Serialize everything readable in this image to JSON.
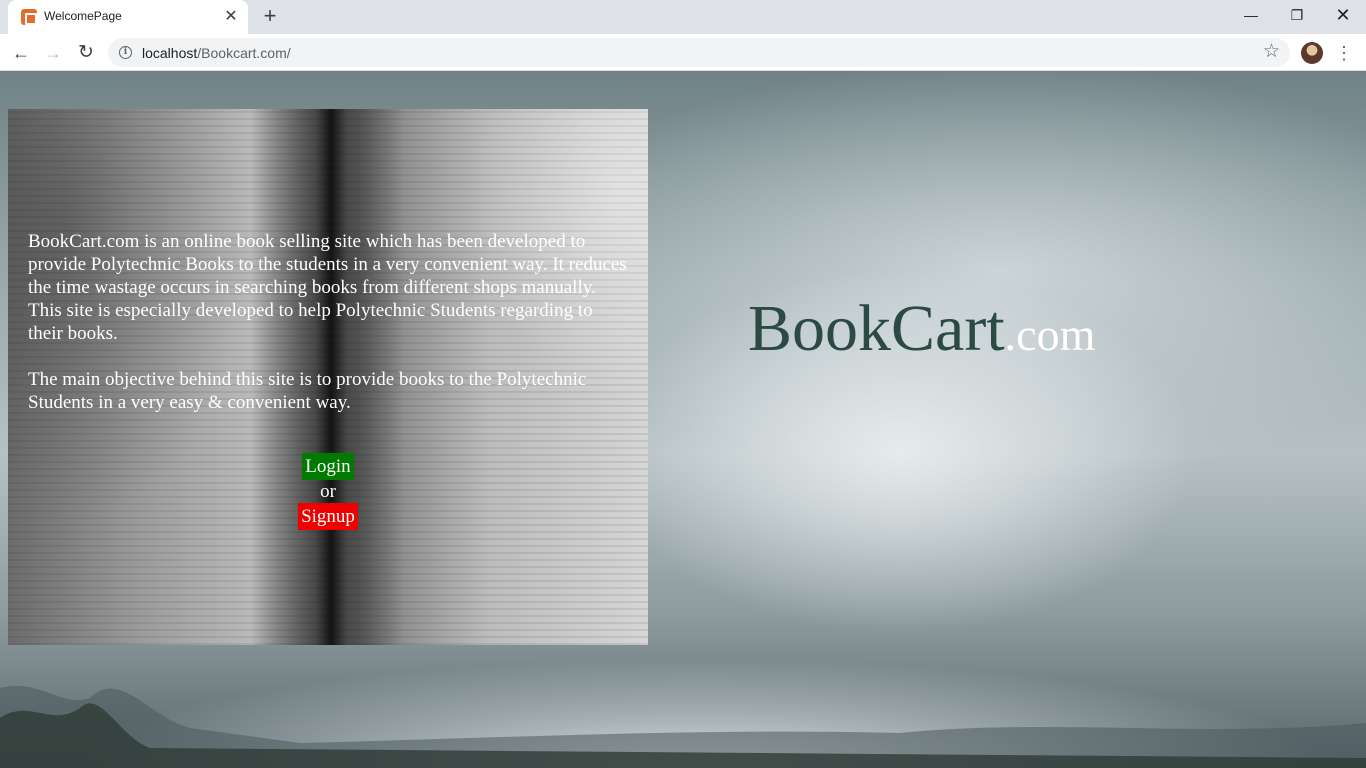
{
  "browser": {
    "tab_title": "WelcomePage",
    "url_host": "localhost",
    "url_path": "/Bookcart.com/",
    "icons": {
      "favicon": "xampp-icon",
      "tab_close": "close-icon",
      "new_tab": "plus-icon",
      "back": "arrow-left-icon",
      "forward": "arrow-right-icon",
      "reload": "reload-icon",
      "info": "info-icon",
      "bookmark": "star-icon",
      "profile": "avatar",
      "menu": "kebab-menu-icon"
    }
  },
  "page": {
    "intro_paragraph_1": "BookCart.com is an online book selling site which has been developed to provide Polytechnic Books to the students in a very convenient way. It reduces the time wastage occurs in searching books from different shops manually.",
    "intro_paragraph_2": "This site is especially developed to help Polytechnic Students regarding to their books.",
    "intro_paragraph_3": "The main objective behind this site is to provide books to the Polytechnic Students in a very easy & convenient way.",
    "login_label": "Login",
    "or_label": "or",
    "signup_label": "Signup",
    "brand_main": "BookCart",
    "brand_tld": ".com",
    "colors": {
      "login_bg": "#007a00",
      "signup_bg": "#ee0000",
      "brand_text": "#2c4a44"
    }
  }
}
